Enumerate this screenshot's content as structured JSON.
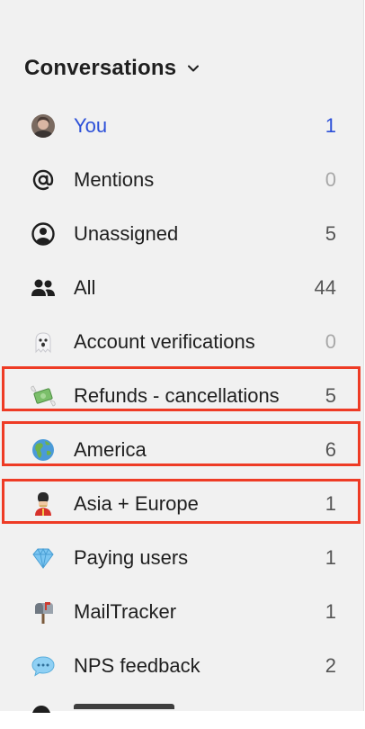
{
  "colors": {
    "active": "#2b4fd8",
    "highlight": "#ee3b25",
    "panel_bg": "#f1f1f1"
  },
  "header": {
    "title": "Conversations",
    "toggle_icon": "chevron-down-icon"
  },
  "items": [
    {
      "label": "You",
      "count": "1",
      "icon": "user-avatar",
      "active": true
    },
    {
      "label": "Mentions",
      "count": "0",
      "icon": "at-sign-icon"
    },
    {
      "label": "Unassigned",
      "count": "5",
      "icon": "user-circle-icon"
    },
    {
      "label": "All",
      "count": "44",
      "icon": "users-icon"
    },
    {
      "label": "Account verifications",
      "count": "0",
      "icon": "ghost-emoji-icon"
    },
    {
      "label": "Refunds - cancellations",
      "count": "5",
      "icon": "money-with-wings-icon",
      "highlighted": true
    },
    {
      "label": "America",
      "count": "6",
      "icon": "globe-americas-icon",
      "highlighted": true
    },
    {
      "label": "Asia + Europe",
      "count": "1",
      "icon": "guardsman-icon",
      "highlighted": true
    },
    {
      "label": "Paying users",
      "count": "1",
      "icon": "gem-icon"
    },
    {
      "label": "MailTracker",
      "count": "1",
      "icon": "mailbox-icon"
    },
    {
      "label": "NPS feedback",
      "count": "2",
      "icon": "speech-bubble-icon"
    }
  ]
}
